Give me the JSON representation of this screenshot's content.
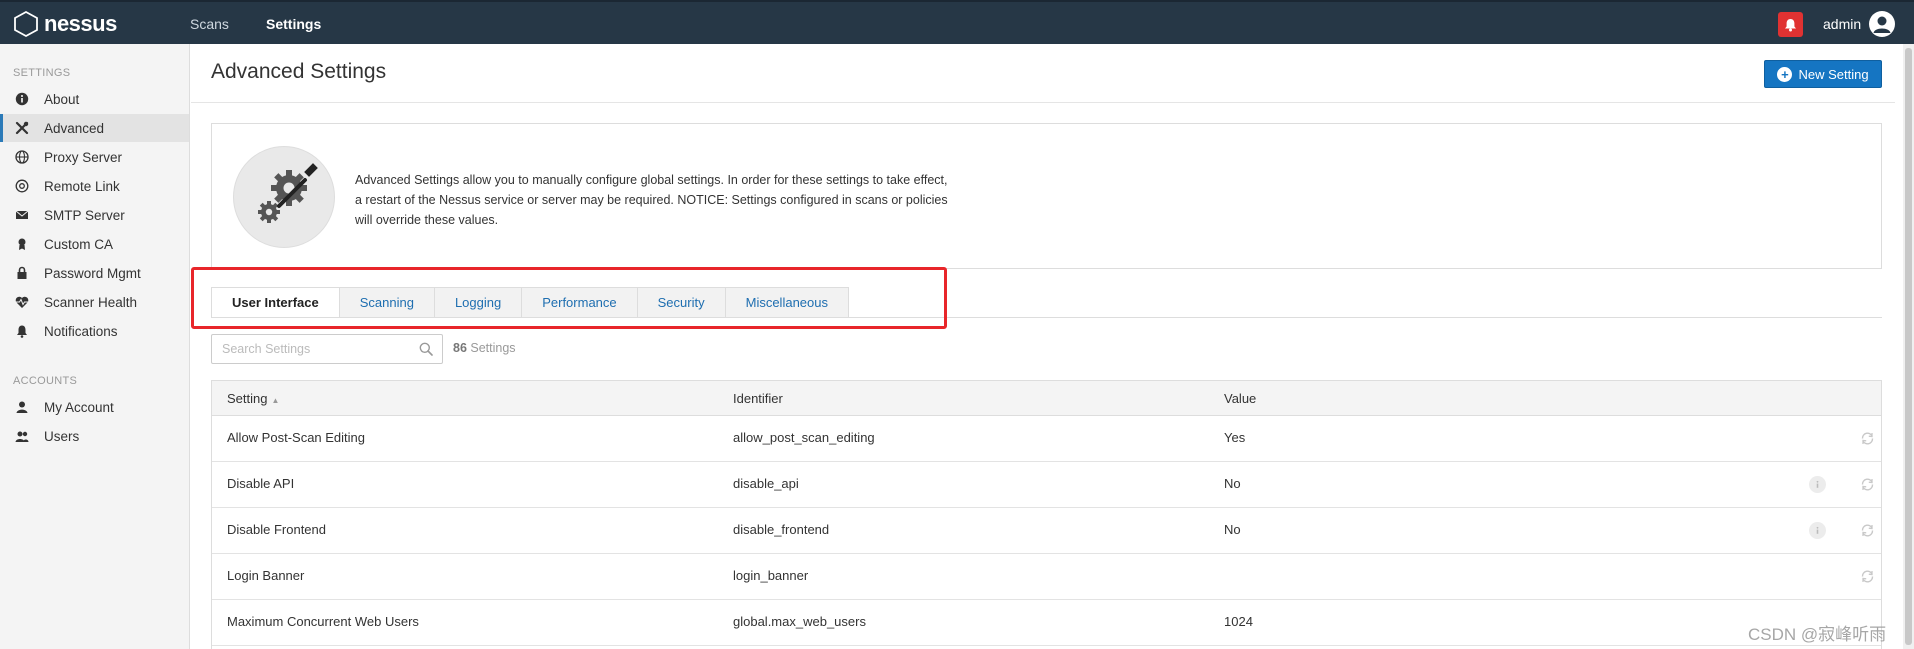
{
  "topbar": {
    "logo_text": "nessus",
    "nav": [
      {
        "label": "Scans",
        "active": false
      },
      {
        "label": "Settings",
        "active": true
      }
    ],
    "user_name": "admin"
  },
  "sidebar": {
    "settings_heading": "SETTINGS",
    "settings_items": [
      {
        "label": "About",
        "icon": "info-icon",
        "active": false
      },
      {
        "label": "Advanced",
        "icon": "tools-icon",
        "active": true
      },
      {
        "label": "Proxy Server",
        "icon": "globe-icon",
        "active": false
      },
      {
        "label": "Remote Link",
        "icon": "link-icon",
        "active": false
      },
      {
        "label": "SMTP Server",
        "icon": "envelope-icon",
        "active": false
      },
      {
        "label": "Custom CA",
        "icon": "certificate-icon",
        "active": false
      },
      {
        "label": "Password Mgmt",
        "icon": "lock-icon",
        "active": false
      },
      {
        "label": "Scanner Health",
        "icon": "heartbeat-icon",
        "active": false
      },
      {
        "label": "Notifications",
        "icon": "bell-icon",
        "active": false
      }
    ],
    "accounts_heading": "ACCOUNTS",
    "accounts_items": [
      {
        "label": "My Account",
        "icon": "user-icon"
      },
      {
        "label": "Users",
        "icon": "users-icon"
      }
    ]
  },
  "main": {
    "page_title": "Advanced Settings",
    "new_setting_label": "New Setting",
    "info_text": "Advanced Settings allow you to manually configure global settings. In order for these settings to take effect, a restart of the Nessus service or server may be required. NOTICE: Settings configured in scans or policies will override these values.",
    "tabs": [
      {
        "label": "User Interface",
        "active": true
      },
      {
        "label": "Scanning",
        "active": false
      },
      {
        "label": "Logging",
        "active": false
      },
      {
        "label": "Performance",
        "active": false
      },
      {
        "label": "Security",
        "active": false
      },
      {
        "label": "Miscellaneous",
        "active": false
      }
    ],
    "search_placeholder": "Search Settings",
    "settings_count": "86",
    "settings_count_label": "Settings",
    "table": {
      "headers": {
        "setting": "Setting",
        "identifier": "Identifier",
        "value": "Value"
      },
      "rows": [
        {
          "setting": "Allow Post-Scan Editing",
          "identifier": "allow_post_scan_editing",
          "value": "Yes",
          "info": false
        },
        {
          "setting": "Disable API",
          "identifier": "disable_api",
          "value": "No",
          "info": true
        },
        {
          "setting": "Disable Frontend",
          "identifier": "disable_frontend",
          "value": "No",
          "info": true
        },
        {
          "setting": "Login Banner",
          "identifier": "login_banner",
          "value": "",
          "info": false
        },
        {
          "setting": "Maximum Concurrent Web Users",
          "identifier": "global.max_web_users",
          "value": "1024",
          "info": false
        }
      ]
    }
  },
  "watermark": "CSDN @寂峰听雨",
  "colors": {
    "topbar": "#263746",
    "accent": "#1575c2",
    "alert": "#e03232",
    "highlight_box": "#e8262a"
  }
}
